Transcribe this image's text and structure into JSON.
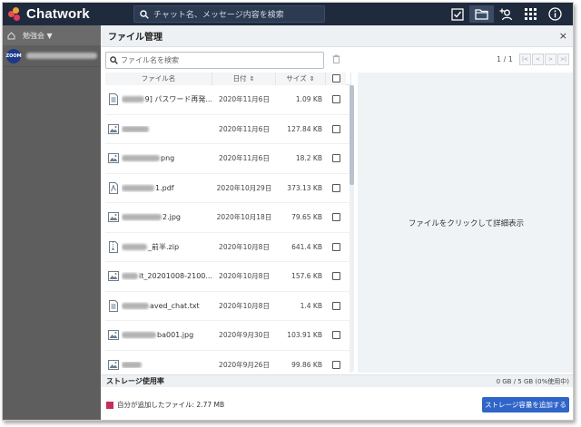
{
  "app": {
    "logo_text": "Chatwork"
  },
  "colors": {
    "accent": "#2f64c8",
    "topbar": "#1f2a3c",
    "legend": "#c2315a"
  },
  "top_search": {
    "placeholder": "チャット名、メッセージ内容を検索"
  },
  "top_icons": [
    "task-icon",
    "folder-icon",
    "add-contact-icon",
    "apps-grid-icon",
    "info-icon"
  ],
  "sidebar": {
    "group_label": "勉強会 ▼",
    "avatar_text": "ZOOM"
  },
  "modal": {
    "title": "ファイル管理",
    "close": "×",
    "search_placeholder": "ファイル名を検索",
    "page_indicator": "1 / 1",
    "pager_buttons": [
      "|<",
      "<",
      ">",
      ">|"
    ],
    "columns": {
      "name": "ファイル名",
      "date": "日付",
      "size": "サイズ"
    },
    "files": [
      {
        "icon": "document-icon",
        "name": "9] パスワード再発...",
        "date": "2020年11月6日",
        "size": "1.09 KB"
      },
      {
        "icon": "image-icon",
        "name": "",
        "date": "2020年11月6日",
        "size": "127.84 KB"
      },
      {
        "icon": "image-icon",
        "name": "png",
        "date": "2020年11月6日",
        "size": "18.2 KB"
      },
      {
        "icon": "pdf-icon",
        "name": "1.pdf",
        "date": "2020年10月29日",
        "size": "373.13 KB"
      },
      {
        "icon": "image-icon",
        "name": "2.jpg",
        "date": "2020年10月18日",
        "size": "79.65 KB"
      },
      {
        "icon": "zip-icon",
        "name": "_前半.zip",
        "date": "2020年10月8日",
        "size": "641.4 KB"
      },
      {
        "icon": "image-icon",
        "name": "it_20201008-2100...",
        "date": "2020年10月8日",
        "size": "157.6 KB"
      },
      {
        "icon": "document-icon",
        "name": "aved_chat.txt",
        "date": "2020年10月8日",
        "size": "1.4 KB"
      },
      {
        "icon": "image-icon",
        "name": "ba001.jpg",
        "date": "2020年9月30日",
        "size": "103.91 KB"
      },
      {
        "icon": "image-icon",
        "name": "",
        "date": "2020年9月26日",
        "size": "99.86 KB"
      }
    ],
    "preview_hint": "ファイルをクリックして詳細表示",
    "storage_label": "ストレージ使用率",
    "storage_value": "0 GB / 5 GB (0%使用中)",
    "legend_text": "自分が追加したファイル: 2.77 MB",
    "add_storage_button": "ストレージ容量を追加する"
  }
}
